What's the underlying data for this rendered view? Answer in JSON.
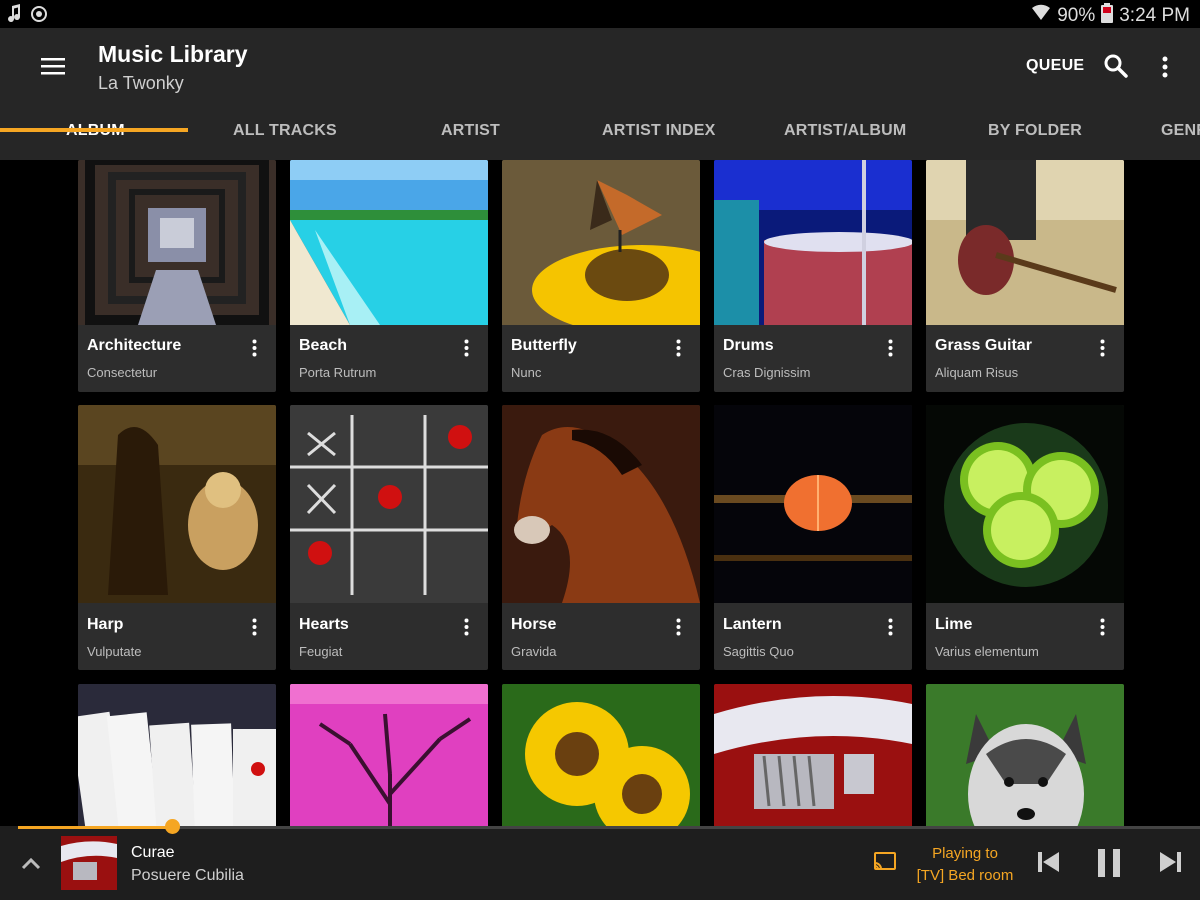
{
  "status": {
    "left_icons": [
      "music-note-icon",
      "sync-icon"
    ],
    "battery": "90%",
    "time": "3:24 PM",
    "icons": [
      "wifi-icon",
      "battery-icon"
    ]
  },
  "header": {
    "title": "Music Library",
    "subtitle": "La Twonky",
    "queue_label": "QUEUE",
    "icons": [
      "menu-icon",
      "search-icon",
      "more-vertical-icon"
    ]
  },
  "tabs": [
    {
      "label": "ALBUM",
      "active": true
    },
    {
      "label": "ALL TRACKS"
    },
    {
      "label": "ARTIST"
    },
    {
      "label": "ARTIST INDEX"
    },
    {
      "label": "ARTIST/ALBUM"
    },
    {
      "label": "BY FOLDER"
    },
    {
      "label": "GENR"
    }
  ],
  "colors": {
    "accent": "#f5a623",
    "appbar": "#262626",
    "card": "#2d2d2d",
    "background": "#000000"
  },
  "albums": [
    {
      "title": "Architecture",
      "subtitle": "Consectetur"
    },
    {
      "title": "Beach",
      "subtitle": "Porta Rutrum"
    },
    {
      "title": "Butterfly",
      "subtitle": "Nunc"
    },
    {
      "title": "Drums",
      "subtitle": "Cras Dignissim"
    },
    {
      "title": "Grass Guitar",
      "subtitle": "Aliquam Risus"
    },
    {
      "title": "Harp",
      "subtitle": "Vulputate"
    },
    {
      "title": "Hearts",
      "subtitle": "Feugiat"
    },
    {
      "title": "Horse",
      "subtitle": "Gravida"
    },
    {
      "title": "Lantern",
      "subtitle": "Sagittis Quo"
    },
    {
      "title": "Lime",
      "subtitle": "Varius elementum"
    },
    {
      "title": "",
      "subtitle": ""
    },
    {
      "title": "",
      "subtitle": ""
    },
    {
      "title": "",
      "subtitle": ""
    },
    {
      "title": "",
      "subtitle": ""
    },
    {
      "title": "",
      "subtitle": ""
    }
  ],
  "now_playing": {
    "title": "Curae",
    "artist": "Posuere Cubilia",
    "playing_to_line1": "Playing to",
    "playing_to_line2": "[TV] Bed room",
    "progress": 0.13,
    "icons": [
      "chevron-up-icon",
      "cast-icon",
      "skip-previous-icon",
      "pause-icon",
      "skip-next-icon"
    ]
  }
}
